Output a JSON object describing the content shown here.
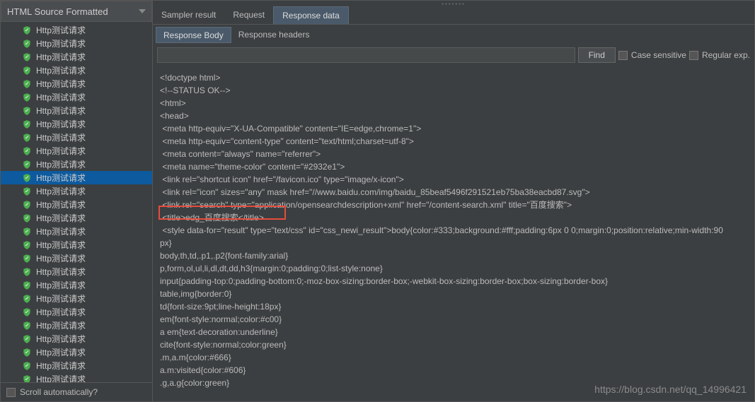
{
  "dropdown": {
    "label": "HTML Source Formatted"
  },
  "tree": {
    "items": [
      "Http测试请求",
      "Http测试请求",
      "Http测试请求",
      "Http测试请求",
      "Http测试请求",
      "Http测试请求",
      "Http测试请求",
      "Http测试请求",
      "Http测试请求",
      "Http测试请求",
      "Http测试请求",
      "Http测试请求",
      "Http测试请求",
      "Http测试请求",
      "Http测试请求",
      "Http测试请求",
      "Http测试请求",
      "Http测试请求",
      "Http测试请求",
      "Http测试请求",
      "Http测试请求",
      "Http测试请求",
      "Http测试请求",
      "Http测试请求",
      "Http测试请求",
      "Http测试请求",
      "Http测试请求"
    ],
    "selectedIndex": 11
  },
  "scrollAuto": {
    "label": "Scroll automatically?"
  },
  "tabs": {
    "items": [
      "Sampler result",
      "Request",
      "Response data"
    ],
    "activeIndex": 2
  },
  "subTabs": {
    "items": [
      "Response Body",
      "Response headers"
    ],
    "activeIndex": 0
  },
  "search": {
    "value": "",
    "placeholder": "",
    "findLabel": "Find",
    "caseLabel": "Case sensitive",
    "regexLabel": "Regular exp."
  },
  "response": {
    "lines": [
      "<!doctype html>",
      "<!--STATUS OK-->",
      "<html>",
      "<head>",
      " <meta http-equiv=\"X-UA-Compatible\" content=\"IE=edge,chrome=1\">",
      " <meta http-equiv=\"content-type\" content=\"text/html;charset=utf-8\">",
      " <meta content=\"always\" name=\"referrer\">",
      " <meta name=\"theme-color\" content=\"#2932e1\">",
      " <link rel=\"shortcut icon\" href=\"/favicon.ico\" type=\"image/x-icon\">",
      " <link rel=\"icon\" sizes=\"any\" mask href=\"//www.baidu.com/img/baidu_85beaf5496f291521eb75ba38eacbd87.svg\">",
      " <link rel=\"search\" type=\"application/opensearchdescription+xml\" href=\"/content-search.xml\" title=\"百度搜索\">",
      " <title>edg_百度搜索</title>",
      " <style data-for=\"result\" type=\"text/css\" id=\"css_newi_result\">body{color:#333;background:#fff;padding:6px 0 0;margin:0;position:relative;min-width:90",
      "px}",
      "body,th,td,.p1,.p2{font-family:arial}",
      "p,form,ol,ul,li,dl,dt,dd,h3{margin:0;padding:0;list-style:none}",
      "input{padding-top:0;padding-bottom:0;-moz-box-sizing:border-box;-webkit-box-sizing:border-box;box-sizing:border-box}",
      "table,img{border:0}",
      "td{font-size:9pt;line-height:18px}",
      "em{font-style:normal;color:#c00}",
      "a em{text-decoration:underline}",
      "cite{font-style:normal;color:green}",
      ".m,a.m{color:#666}",
      "a.m:visited{color:#606}",
      ".g,a.g{color:green}"
    ]
  },
  "watermark": "https://blog.csdn.net/qq_14996421"
}
